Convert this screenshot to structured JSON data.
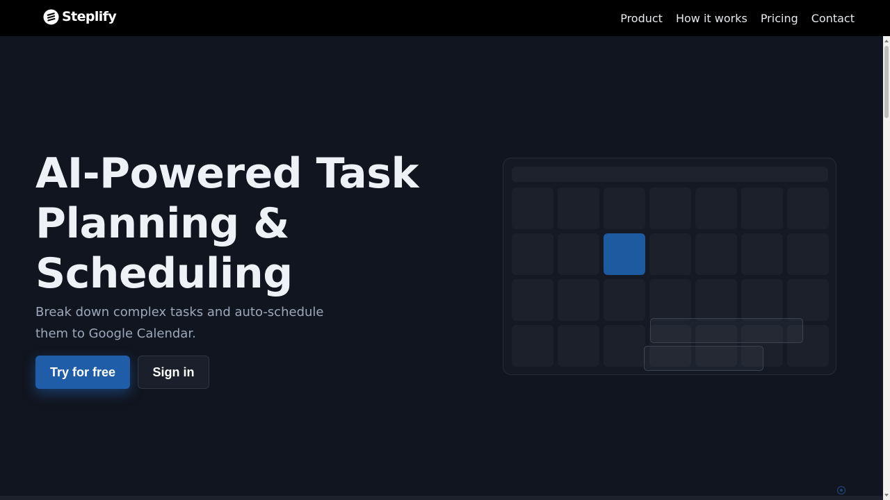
{
  "brand": {
    "name": "Steplify",
    "logo_icon": "steplify-logo-icon"
  },
  "nav": {
    "items": [
      {
        "label": "Product"
      },
      {
        "label": "How it works"
      },
      {
        "label": "Pricing"
      },
      {
        "label": "Contact"
      }
    ]
  },
  "hero": {
    "title_lines": [
      "AI-Powered Task",
      "Planning &",
      "Scheduling"
    ],
    "subtitle": "Break down complex tasks and auto-schedule them to Google Calendar.",
    "primary_button": "Try for free",
    "secondary_button": "Sign in"
  },
  "calendar_preview": {
    "columns": 7,
    "rows": 4,
    "highlighted_cell": {
      "row": 2,
      "column": 3
    }
  },
  "colors": {
    "background": "#11151f",
    "topbar": "#000000",
    "accent": "#1f5da8",
    "highlight_cell": "#1d5aa0"
  }
}
